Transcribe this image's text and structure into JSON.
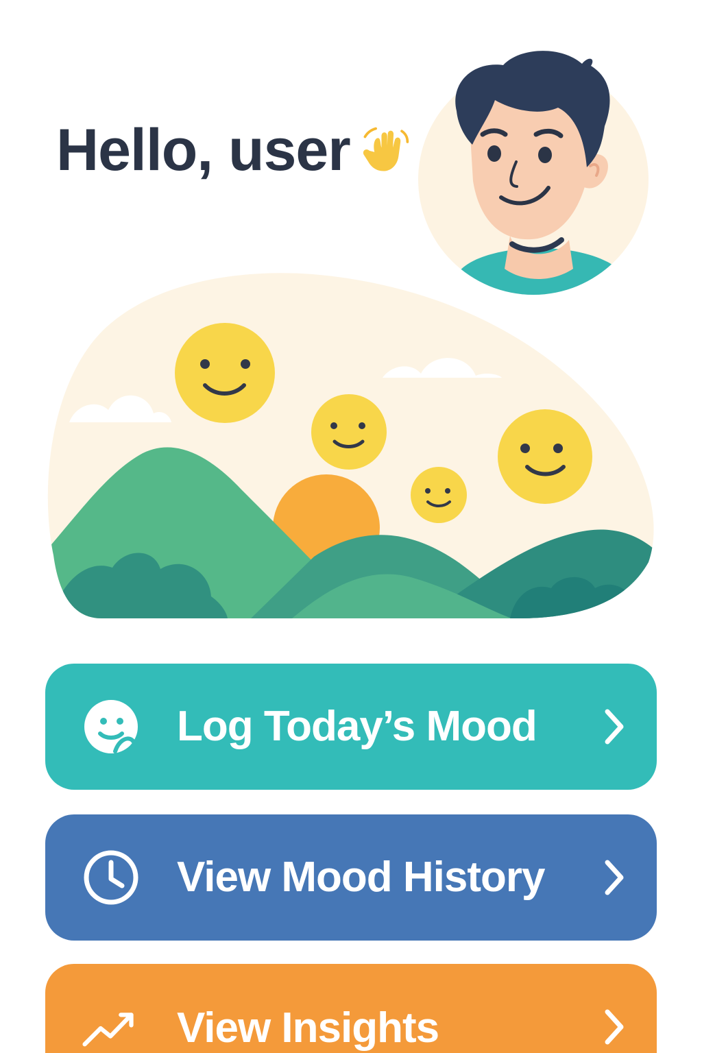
{
  "header": {
    "greeting": "Hello, user",
    "greeting_emoji": "waving-hand-icon",
    "avatar": "user-avatar"
  },
  "hero": {
    "illustration": "mood-landscape-illustration"
  },
  "actions": [
    {
      "label": "Log Today’s Mood",
      "icon": "mood-face-icon",
      "chevron": "chevron-right-icon",
      "color": "#33bcb8"
    },
    {
      "label": "View Mood History",
      "icon": "clock-icon",
      "chevron": "chevron-right-icon",
      "color": "#4677b6"
    },
    {
      "label": "View Insights",
      "icon": "trend-up-icon",
      "chevron": "chevron-right-icon",
      "color": "#f49a3a"
    }
  ],
  "colors": {
    "text_dark": "#2b3446",
    "teal": "#33bcb8",
    "blue": "#4677b6",
    "orange": "#f49a3a",
    "emoji_yellow": "#f8d64a",
    "hill_green": "#53b889",
    "background_cream": "#fdf4e4"
  }
}
